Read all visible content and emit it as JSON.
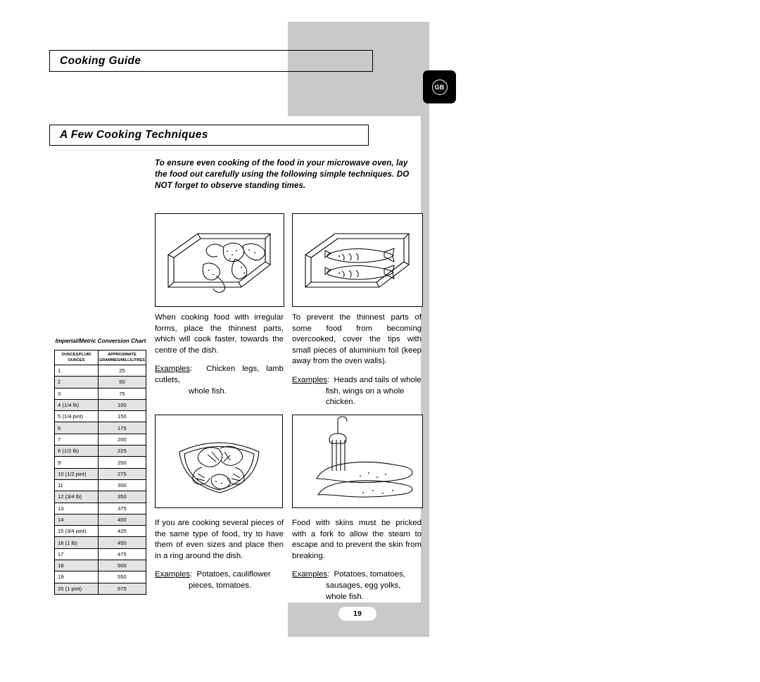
{
  "header": {
    "guide_title": "Cooking Guide",
    "region_badge": "GB"
  },
  "section": {
    "title": "A Few Cooking Techniques",
    "intro": "To ensure even cooking of the food in your microwave oven, lay the food out carefully using the following simple techniques. DO NOT forget to observe standing times."
  },
  "panels": [
    {
      "id": "irregular-forms",
      "body": "When cooking food with irregular forms, place the thinnest parts, which will cook faster, towards the centre of the dish.",
      "examples_label": "Examples",
      "examples_line1": "Chicken legs, lamb cutlets,",
      "examples_line2": "whole fish."
    },
    {
      "id": "thin-parts-foil",
      "body": "To prevent the thinnest parts of some food from becoming overcooked, cover the tips with small pieces of aluminium foil (keep away from the oven walls).",
      "examples_label": "Examples",
      "examples_line1": "Heads and tails of whole",
      "examples_line2": "fish, wings on a whole",
      "examples_line3": "chicken."
    },
    {
      "id": "ring-arrangement",
      "body": "If you are cooking several pieces of the same type of food, try to have them of even sizes and place then in a ring around the dish.",
      "examples_label": "Examples",
      "examples_line1": "Potatoes, cauliflower",
      "examples_line2": "pieces, tomatoes."
    },
    {
      "id": "pricking-skins",
      "body": "Food with skins must be pricked with a fork to allow the steam to escape and to prevent the skin from breaking.",
      "examples_label": "Examples",
      "examples_line1": "Potatoes, tomatoes,",
      "examples_line2": "sausages, egg yolks,",
      "examples_line3": "whole fish."
    }
  ],
  "conversion_chart": {
    "title": "Imperial/Metric Conversion Chart",
    "headers": [
      "OUNCES/FLUID OUNCES",
      "APPROXIMATE GRAMMES/MILLILITRES"
    ],
    "header_line1_a": "OUNCES/FLUID",
    "header_line2_a": "OUNCES",
    "header_line1_b": "APPROXIMATE",
    "header_line2_b": "GRAMMES/MILLILITRES",
    "rows": [
      {
        "imperial": "1",
        "metric": "25"
      },
      {
        "imperial": "2",
        "metric": "50"
      },
      {
        "imperial": "3",
        "metric": "75"
      },
      {
        "imperial": "4  (1/4 lb)",
        "metric": "100"
      },
      {
        "imperial": "5  (1/4 pint)",
        "metric": "150"
      },
      {
        "imperial": "6",
        "metric": "175"
      },
      {
        "imperial": "7",
        "metric": "200"
      },
      {
        "imperial": "8  (1/2 lb)",
        "metric": "225"
      },
      {
        "imperial": "9",
        "metric": "250"
      },
      {
        "imperial": "10 (1/2 pint)",
        "metric": "275"
      },
      {
        "imperial": "11",
        "metric": "300"
      },
      {
        "imperial": "12 (3/4 lb)",
        "metric": "350"
      },
      {
        "imperial": "13",
        "metric": "375"
      },
      {
        "imperial": "14",
        "metric": "400"
      },
      {
        "imperial": "15 (3/4 pint)",
        "metric": "425"
      },
      {
        "imperial": "16 (1 lb)",
        "metric": "450"
      },
      {
        "imperial": "17",
        "metric": "475"
      },
      {
        "imperial": "18",
        "metric": "500"
      },
      {
        "imperial": "19",
        "metric": "550"
      },
      {
        "imperial": "20 (1 pint)",
        "metric": "575"
      }
    ]
  },
  "footer": {
    "page_number": "19"
  }
}
